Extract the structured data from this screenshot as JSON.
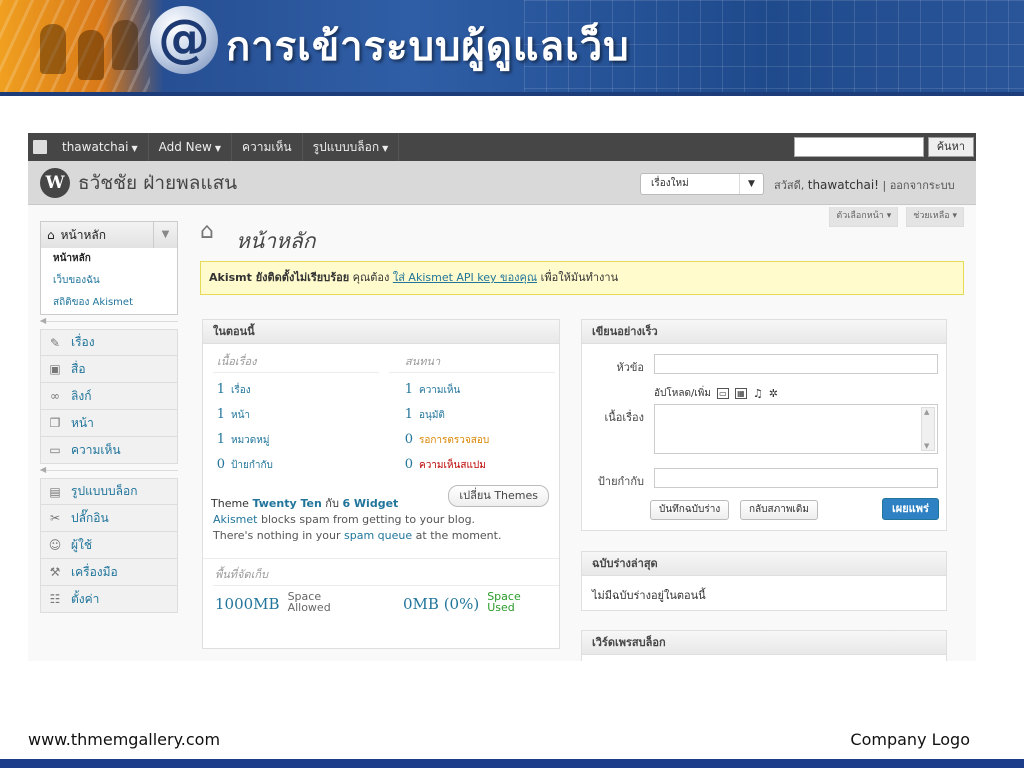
{
  "slide": {
    "title": "การเข้าระบบผู้ดูแลเว็บ",
    "at_symbol": "@",
    "footer_url": "www.thmemgallery.com",
    "footer_logo": "Company Logo"
  },
  "adminbar": {
    "user": "thawatchai",
    "add_new": "Add New",
    "comments": "ความเห็น",
    "appearance": "รูปแบบบล็อก",
    "search_button": "ค้นหา",
    "search_placeholder": ""
  },
  "site_header": {
    "logo_glyph": "W",
    "site_name": "ธวัชชัย ฝ่ายพลแสน",
    "new_select": "เรื่องใหม่",
    "greeting": "สวัสดี,",
    "username": "thawatchai!",
    "logout": "| ออกจากระบบ"
  },
  "sidebar": {
    "home_label": "หน้าหลัก",
    "submenu": [
      "หน้าหลัก",
      "เว็บของฉัน",
      "สถิติของ Akismet"
    ],
    "group1": [
      {
        "icon": "pin-icon",
        "glyph": "✎",
        "label": "เรื่อง"
      },
      {
        "icon": "media-icon",
        "glyph": "▣",
        "label": "สื่อ"
      },
      {
        "icon": "link-icon",
        "glyph": "∞",
        "label": "ลิงก์"
      },
      {
        "icon": "pages-icon",
        "glyph": "❐",
        "label": "หน้า"
      },
      {
        "icon": "comments-icon",
        "glyph": "▭",
        "label": "ความเห็น"
      }
    ],
    "group2": [
      {
        "icon": "appearance-icon",
        "glyph": "▤",
        "label": "รูปแบบบล็อก"
      },
      {
        "icon": "plugins-icon",
        "glyph": "✂",
        "label": "ปลั๊กอิน"
      },
      {
        "icon": "users-icon",
        "glyph": "☺",
        "label": "ผู้ใช้"
      },
      {
        "icon": "tools-icon",
        "glyph": "⚒",
        "label": "เครื่องมือ"
      },
      {
        "icon": "settings-icon",
        "glyph": "☷",
        "label": "ตั้งค่า"
      }
    ]
  },
  "page": {
    "title": "หน้าหลัก",
    "screen_options": "ตัวเลือกหน้า ▾",
    "help": "ช่วยเหลือ ▾"
  },
  "notice": {
    "bold": "Akismt ยังติดตั้งไม่เรียบร้อย",
    "text1": " คุณต้อง ",
    "link": "ใส่ Akismet API key ของคุณ",
    "text2": " เพื่อให้มันทำงาน"
  },
  "right_now": {
    "heading": "ในตอนนี้",
    "content_header": "เนื้อเรื่อง",
    "discussion_header": "สนทนา",
    "content": [
      {
        "n": "1",
        "label": "เรื่อง"
      },
      {
        "n": "1",
        "label": "หน้า"
      },
      {
        "n": "1",
        "label": "หมวดหมู่"
      },
      {
        "n": "0",
        "label": "ป้ายกำกับ"
      }
    ],
    "discussion": [
      {
        "n": "1",
        "label": "ความเห็น"
      },
      {
        "n": "1",
        "label": "อนุมัติ"
      },
      {
        "n": "0",
        "label": "รอการตรวจสอบ"
      },
      {
        "n": "0",
        "label": "ความเห็นสแปม"
      }
    ],
    "theme_prefix": "Theme ",
    "theme_name": "Twenty Ten",
    "theme_mid": " กับ ",
    "widgets": "6 Widget",
    "change_theme": "เปลี่ยน Themes",
    "akismet_1a": "Akismet",
    "akismet_1b": " blocks spam from getting to your blog.",
    "akismet_2a": "There's nothing in your ",
    "akismet_2b": "spam queue",
    "akismet_2c": " at the moment.",
    "storage_header": "พื้นที่จัดเก็บ",
    "space_allowed_val": "1000MB",
    "space_allowed_1": "Space",
    "space_allowed_2": "Allowed",
    "space_used_val": "0MB (0%)",
    "space_used_1": "Space",
    "space_used_2": "Used"
  },
  "quick_press": {
    "heading": "เขียนอย่างเร็ว",
    "title_label": "หัวข้อ",
    "upload_label": "อัปโหลด/เพิ่ม",
    "content_label": "เนื้อเรื่อง",
    "tags_label": "ป้ายกำกับ",
    "save_draft": "บันทึกฉบับร่าง",
    "reset": "กลับสภาพเดิม",
    "publish": "เผยแพร่"
  },
  "drafts": {
    "heading": "ฉบับร่างล่าสุด",
    "empty": "ไม่มีฉบับร่างอยู่ในตอนนี้"
  },
  "wp_news": {
    "heading": "เวิร์ดเพรสบล็อก"
  }
}
